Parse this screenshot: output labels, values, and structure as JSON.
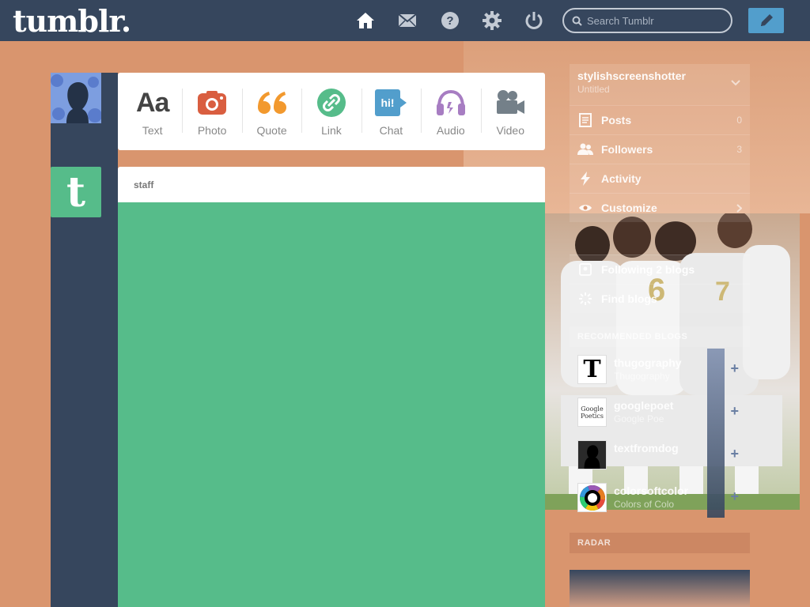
{
  "header": {
    "logo": "tumblr.",
    "nav_icons": [
      "home-icon",
      "mail-icon",
      "help-icon",
      "settings-icon",
      "power-icon"
    ],
    "search_placeholder": "Search Tumblr",
    "compose_icon": "pencil-icon"
  },
  "post_types": [
    {
      "label": "Text",
      "icon": "text-icon",
      "color": "#444444"
    },
    {
      "label": "Photo",
      "icon": "camera-icon",
      "color": "#d95e40"
    },
    {
      "label": "Quote",
      "icon": "quote-icon",
      "color": "#f2992e"
    },
    {
      "label": "Link",
      "icon": "link-icon",
      "color": "#56bc8a"
    },
    {
      "label": "Chat",
      "icon": "chat-icon",
      "color": "#529ecc"
    },
    {
      "label": "Audio",
      "icon": "headphones-icon",
      "color": "#a77dc2"
    },
    {
      "label": "Video",
      "icon": "video-camera-icon",
      "color": "#748089"
    }
  ],
  "post": {
    "author": "staff",
    "body_color": "#56bc8a"
  },
  "sidebar": {
    "blog_name": "stylishscreenshotter",
    "blog_subtitle": "Untitled",
    "items": [
      {
        "label": "Posts",
        "icon": "document-icon",
        "count": "0"
      },
      {
        "label": "Followers",
        "icon": "people-icon",
        "count": "3"
      },
      {
        "label": "Activity",
        "icon": "lightning-icon",
        "count": ""
      },
      {
        "label": "Customize",
        "icon": "eye-icon",
        "count": ""
      }
    ],
    "items2": [
      {
        "label": "Following 2 blogs",
        "icon": "following-icon"
      },
      {
        "label": "Find blogs",
        "icon": "compass-icon"
      }
    ],
    "recommended_title": "RECOMMENDED BLOGS",
    "recommended": [
      {
        "name": "thugography",
        "sub": "Thugography",
        "avatar": "T"
      },
      {
        "name": "googlepoet",
        "sub": "Google Poe",
        "avatar": "Google Poetics"
      },
      {
        "name": "textfromdog",
        "sub": "",
        "avatar": "dog"
      },
      {
        "name": "colorsoftcolor",
        "sub": "Colors of Colo",
        "avatar": "color-wheel"
      }
    ],
    "radar_title": "RADAR"
  },
  "colors": {
    "navy": "#36465d",
    "background": "#d9956e",
    "accent_blue": "#529ecc",
    "green": "#56bc8a"
  }
}
